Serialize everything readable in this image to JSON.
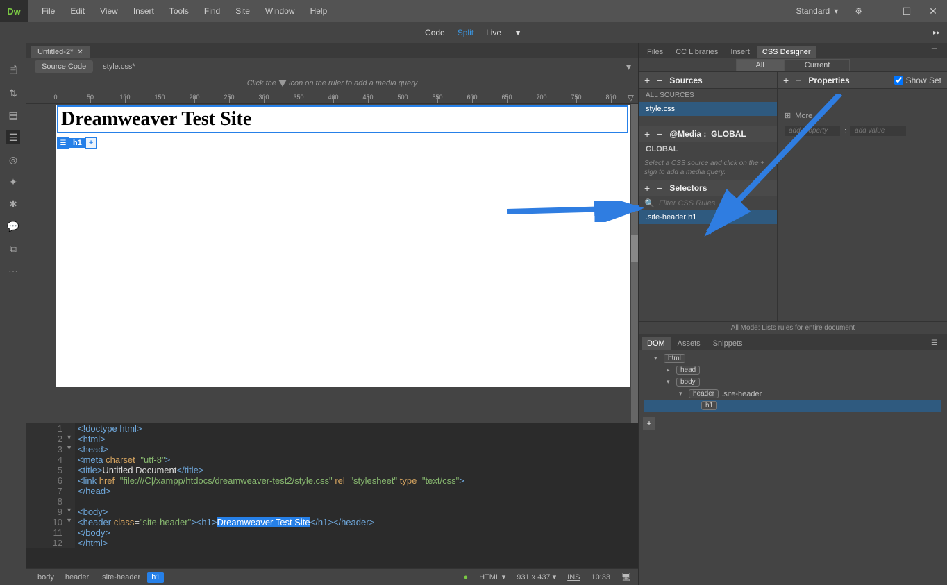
{
  "menu": {
    "items": [
      "File",
      "Edit",
      "View",
      "Insert",
      "Tools",
      "Find",
      "Site",
      "Window",
      "Help"
    ]
  },
  "workspace": "Standard",
  "viewModes": {
    "code": "Code",
    "split": "Split",
    "live": "Live",
    "active": "Split"
  },
  "docTab": "Untitled-2*",
  "related": {
    "source": "Source Code",
    "files": [
      "style.css*"
    ]
  },
  "mediaHint": {
    "pre": "Click the ",
    "post": " icon on the ruler to add a media query"
  },
  "liveHeading": "Dreamweaver Test Site",
  "elementBadge": "h1",
  "code": {
    "lines": [
      {
        "n": 1,
        "html": "<span class='t-tag'>&lt;!doctype html&gt;</span>"
      },
      {
        "n": 2,
        "fold": true,
        "html": "<span class='t-tag'>&lt;html&gt;</span>"
      },
      {
        "n": 3,
        "fold": true,
        "html": "<span class='t-tag'>&lt;head&gt;</span>"
      },
      {
        "n": 4,
        "html": "<span class='t-tag'>&lt;meta</span> <span class='t-attr'>charset</span>=<span class='t-val'>\"utf-8\"</span><span class='t-tag'>&gt;</span>"
      },
      {
        "n": 5,
        "html": "<span class='t-tag'>&lt;title&gt;</span><span class='t-txt'>Untitled Document</span><span class='t-tag'>&lt;/title&gt;</span>"
      },
      {
        "n": 6,
        "html": "<span class='t-tag'>&lt;link</span> <span class='t-attr'>href</span>=<span class='t-val'>\"file:///C|/xampp/htdocs/dreamweaver-test2/style.css\"</span> <span class='t-attr'>rel</span>=<span class='t-val'>\"stylesheet\"</span> <span class='t-attr'>type</span>=<span class='t-val'>\"text/css\"</span><span class='t-tag'>&gt;</span>"
      },
      {
        "n": 7,
        "html": "<span class='t-tag'>&lt;/head&gt;</span>"
      },
      {
        "n": 8,
        "html": ""
      },
      {
        "n": 9,
        "fold": true,
        "html": "<span class='t-tag'>&lt;body&gt;</span>"
      },
      {
        "n": 10,
        "fold": true,
        "html": "<span class='t-tag'>&lt;header</span> <span class='t-attr'>class</span>=<span class='t-val'>\"site-header\"</span><span class='t-tag'>&gt;&lt;h1&gt;</span><span class='hl'>Dreamweaver Test Site</span><span class='t-tag'>&lt;/h1&gt;&lt;/header&gt;</span>"
      },
      {
        "n": 11,
        "html": "<span class='t-tag'>&lt;/body&gt;</span>"
      },
      {
        "n": 12,
        "html": "<span class='t-tag'>&lt;/html&gt;</span>"
      }
    ]
  },
  "breadcrumb": [
    "body",
    "header",
    ".site-header",
    "h1"
  ],
  "status": {
    "lang": "HTML",
    "size": "931 x 437",
    "ins": "INS",
    "time": "10:33"
  },
  "rightTabs": {
    "items": [
      "Files",
      "CC Libraries",
      "Insert",
      "CSS Designer"
    ],
    "active": "CSS Designer"
  },
  "cssSubTabs": {
    "all": "All",
    "current": "Current",
    "active": "All"
  },
  "sources": {
    "title": "Sources",
    "all": "ALL SOURCES",
    "items": [
      "style.css"
    ]
  },
  "media": {
    "title": "@Media :",
    "scope": "GLOBAL",
    "global": "GLOBAL",
    "hint": "Select a CSS source and click on the + sign to add a media query."
  },
  "selectors": {
    "title": "Selectors",
    "filterPlaceholder": "Filter CSS Rules",
    "items": [
      ".site-header h1"
    ]
  },
  "properties": {
    "title": "Properties",
    "showSet": "Show Set",
    "more": "More",
    "addProp": "add property",
    "addVal": "add value"
  },
  "modeFooter": "All Mode: Lists rules for entire document",
  "domTabs": {
    "items": [
      "DOM",
      "Assets",
      "Snippets"
    ],
    "active": "DOM"
  },
  "domTree": {
    "nodes": [
      {
        "indent": 0,
        "arrow": "▾",
        "tag": "html"
      },
      {
        "indent": 1,
        "arrow": "▸",
        "tag": "head"
      },
      {
        "indent": 1,
        "arrow": "▾",
        "tag": "body"
      },
      {
        "indent": 2,
        "arrow": "▾",
        "tag": "header",
        "class": ".site-header"
      },
      {
        "indent": 3,
        "arrow": "",
        "tag": "h1",
        "sel": true
      }
    ]
  }
}
